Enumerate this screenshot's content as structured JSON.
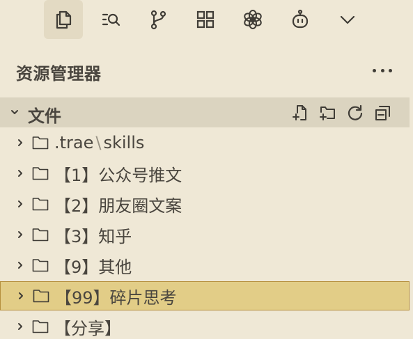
{
  "activity_bar": {
    "items": [
      {
        "id": "explorer",
        "icon": "files-icon",
        "active": true
      },
      {
        "id": "search",
        "icon": "search-list-icon",
        "active": false
      },
      {
        "id": "source-control",
        "icon": "git-branch-icon",
        "active": false
      },
      {
        "id": "extensions",
        "icon": "grid-icon",
        "active": false
      },
      {
        "id": "ai",
        "icon": "ai-flower-icon",
        "active": false
      },
      {
        "id": "agent",
        "icon": "robot-icon",
        "active": false
      },
      {
        "id": "more",
        "icon": "chevron-down-icon",
        "active": false
      }
    ]
  },
  "panel": {
    "title": "资源管理器",
    "more_icon": "ellipsis-icon"
  },
  "section": {
    "title": "文件",
    "actions": [
      "new-file-icon",
      "new-folder-icon",
      "refresh-icon",
      "collapse-all-icon"
    ]
  },
  "tree": {
    "items": [
      {
        "label": ".trae",
        "label_sep": "\\",
        "label_rest": "skills"
      },
      {
        "label": "【1】公众号推文"
      },
      {
        "label": "【2】朋友圈文案"
      },
      {
        "label": "【3】知乎"
      },
      {
        "label": "【9】其他"
      },
      {
        "label": "【99】碎片思考",
        "selected": true
      },
      {
        "label": "【分享】"
      }
    ]
  },
  "colors": {
    "background": "#efe8d6",
    "section_header": "#dbd4c0",
    "active_icon_bg": "#e3dac3",
    "selection": "#e2cd87",
    "selection_border": "#b58f3c",
    "text": "#4a463f"
  }
}
